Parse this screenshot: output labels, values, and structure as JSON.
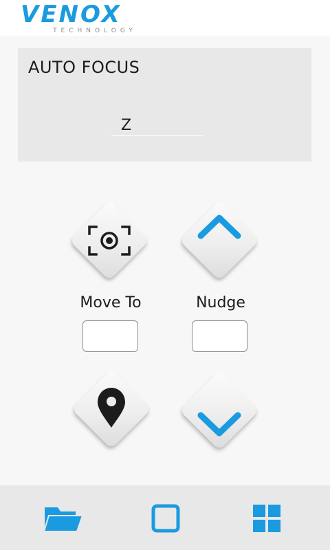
{
  "header": {
    "logo_text": "VENOX",
    "logo_subtext": "TECHNOLOGY"
  },
  "panel": {
    "title": "AUTO FOCUS",
    "z_value": "Z"
  },
  "controls": {
    "move_to_label": "Move To",
    "nudge_label": "Nudge",
    "move_to_value": "",
    "nudge_value": ""
  },
  "icons": {
    "focus": "focus-target-icon",
    "up": "chevron-up-icon",
    "location": "location-pin-icon",
    "down": "chevron-down-icon",
    "folder": "folder-open-icon",
    "square": "square-icon",
    "grid": "grid-icon"
  },
  "colors": {
    "accent": "#1a9be0",
    "dark_icon": "#1c1c1c",
    "panel_bg": "#e8e8e8"
  }
}
